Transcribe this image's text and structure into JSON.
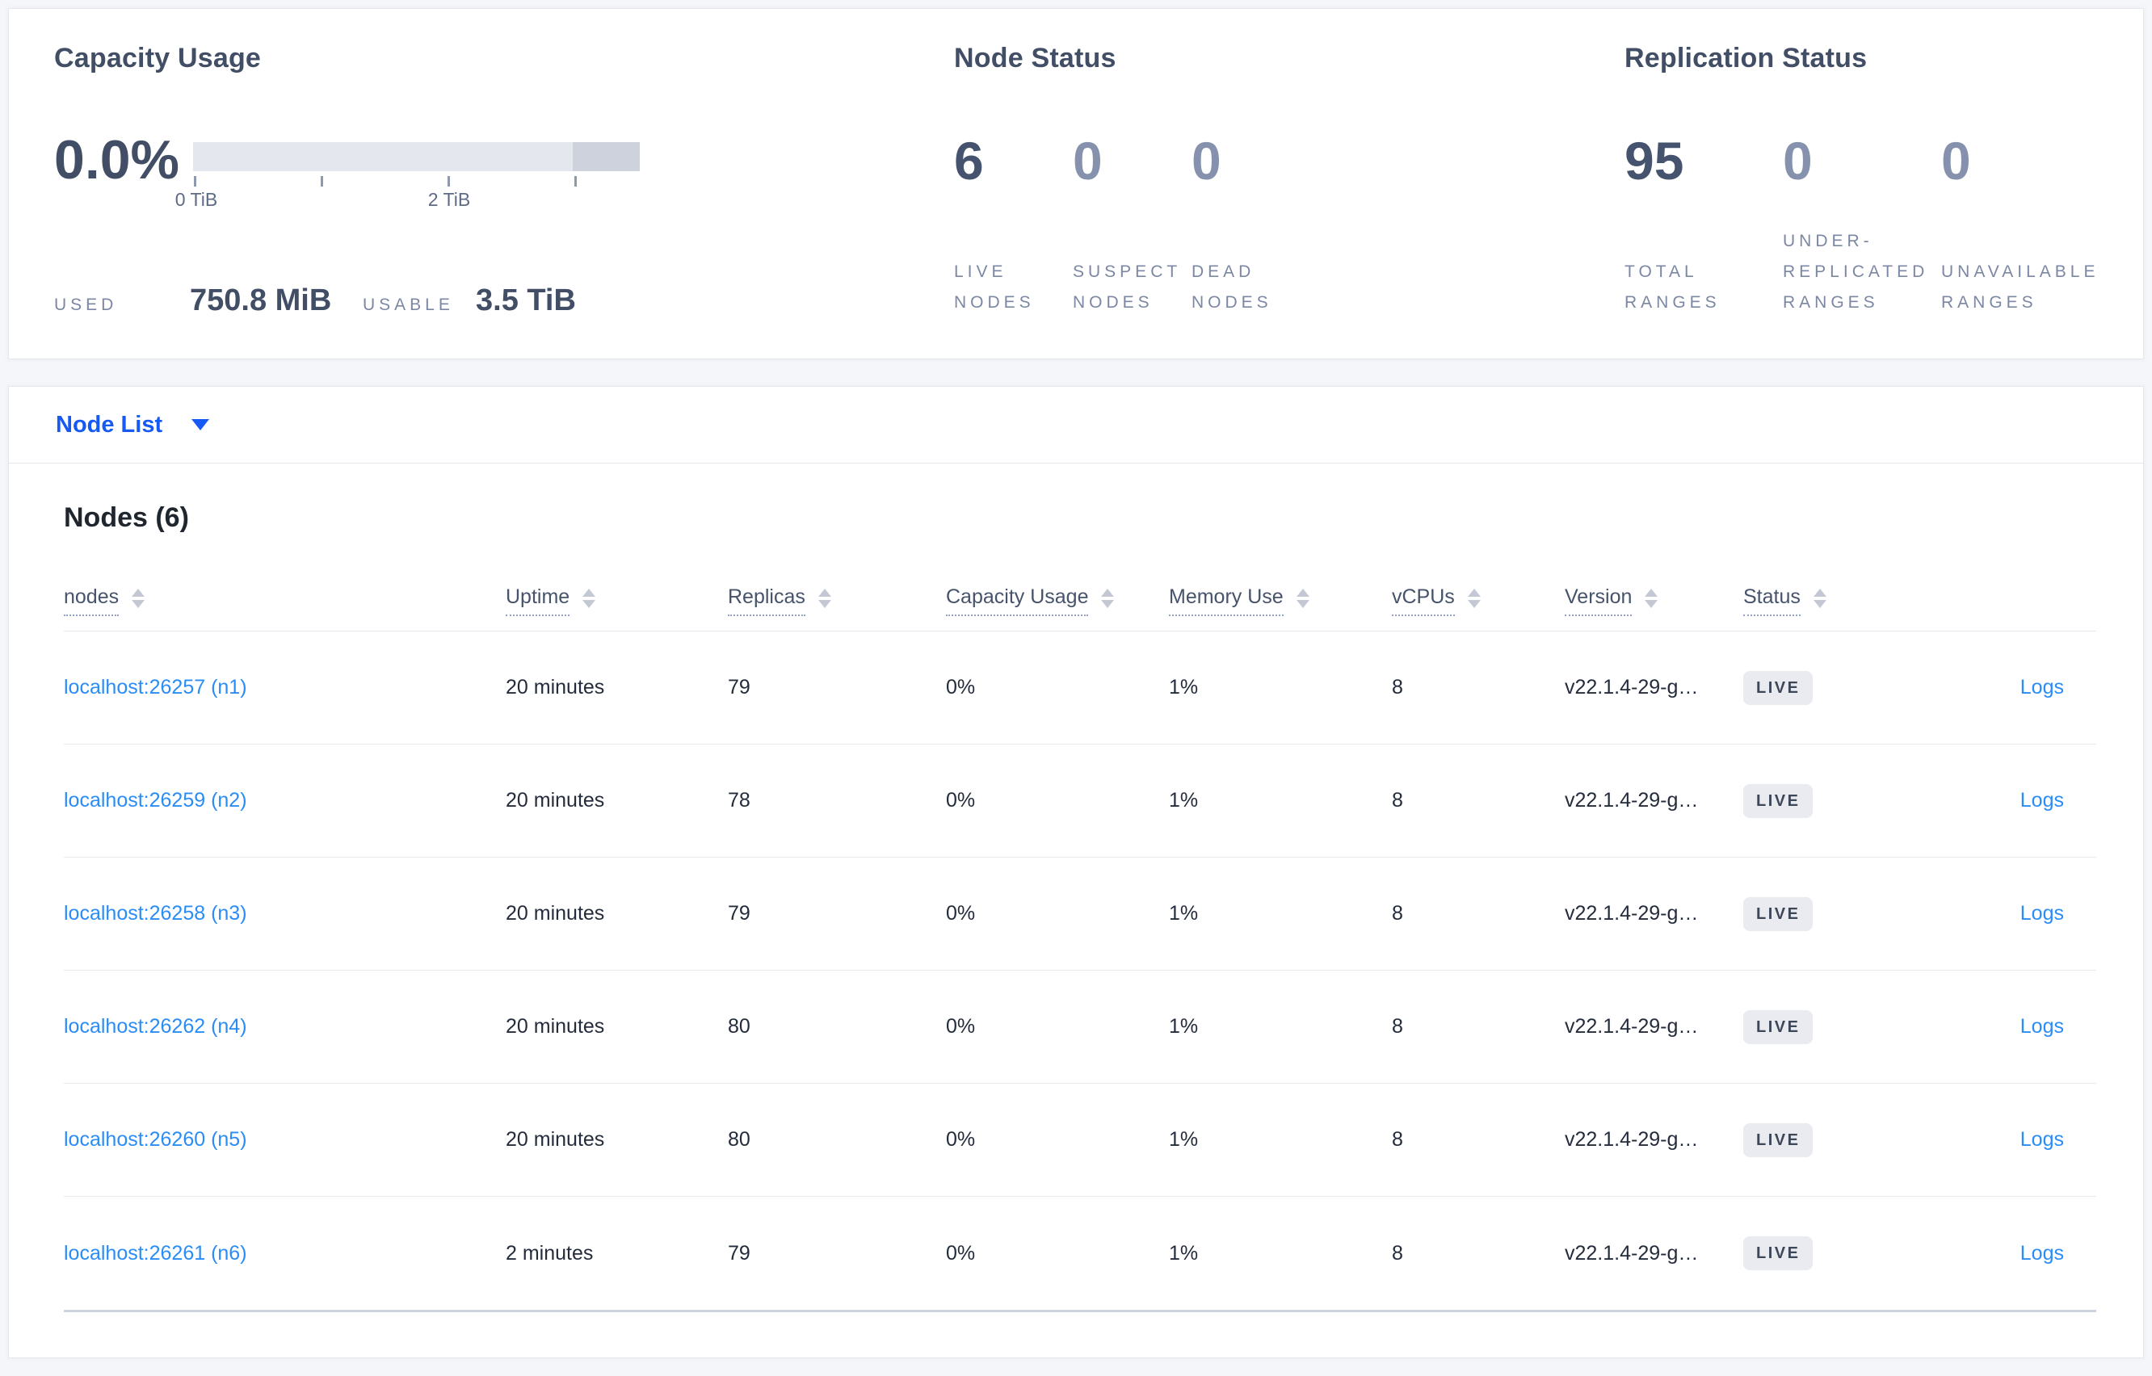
{
  "summary": {
    "capacity": {
      "title": "Capacity Usage",
      "percent_used": "0.0%",
      "axis": {
        "tick_labels": [
          "0 TiB",
          "2 TiB"
        ]
      },
      "used_label": "USED",
      "used_value": "750.8 MiB",
      "usable_label": "USABLE",
      "usable_value": "3.5 TiB"
    },
    "node_status": {
      "title": "Node Status",
      "stats": [
        {
          "value": "6",
          "label": "LIVE NODES",
          "style": "primary"
        },
        {
          "value": "0",
          "label": "SUSPECT NODES",
          "style": "muted"
        },
        {
          "value": "0",
          "label": "DEAD NODES",
          "style": "muted"
        }
      ]
    },
    "replication_status": {
      "title": "Replication Status",
      "stats": [
        {
          "value": "95",
          "label": "TOTAL RANGES",
          "style": "primary"
        },
        {
          "value": "0",
          "label": "UNDER-REPLICATED RANGES",
          "style": "muted"
        },
        {
          "value": "0",
          "label": "UNAVAILABLE RANGES",
          "style": "muted"
        }
      ]
    }
  },
  "view_selector": {
    "selected": "Node List"
  },
  "nodes_table": {
    "title": "Nodes (6)",
    "columns": [
      "nodes",
      "Uptime",
      "Replicas",
      "Capacity Usage",
      "Memory Use",
      "vCPUs",
      "Version",
      "Status"
    ],
    "logs_link_label": "Logs",
    "rows": [
      {
        "address": "localhost:26257 (n1)",
        "uptime": "20 minutes",
        "replicas": "79",
        "capacity_usage": "0%",
        "memory_use": "1%",
        "vcpus": "8",
        "version": "v22.1.4-29-g…",
        "status": "LIVE"
      },
      {
        "address": "localhost:26259 (n2)",
        "uptime": "20 minutes",
        "replicas": "78",
        "capacity_usage": "0%",
        "memory_use": "1%",
        "vcpus": "8",
        "version": "v22.1.4-29-g…",
        "status": "LIVE"
      },
      {
        "address": "localhost:26258 (n3)",
        "uptime": "20 minutes",
        "replicas": "79",
        "capacity_usage": "0%",
        "memory_use": "1%",
        "vcpus": "8",
        "version": "v22.1.4-29-g…",
        "status": "LIVE"
      },
      {
        "address": "localhost:26262 (n4)",
        "uptime": "20 minutes",
        "replicas": "80",
        "capacity_usage": "0%",
        "memory_use": "1%",
        "vcpus": "8",
        "version": "v22.1.4-29-g…",
        "status": "LIVE"
      },
      {
        "address": "localhost:26260 (n5)",
        "uptime": "20 minutes",
        "replicas": "80",
        "capacity_usage": "0%",
        "memory_use": "1%",
        "vcpus": "8",
        "version": "v22.1.4-29-g…",
        "status": "LIVE"
      },
      {
        "address": "localhost:26261 (n6)",
        "uptime": "2 minutes",
        "replicas": "79",
        "capacity_usage": "0%",
        "memory_use": "1%",
        "vcpus": "8",
        "version": "v22.1.4-29-g…",
        "status": "LIVE"
      }
    ]
  },
  "colors": {
    "accent_blue": "#1659f3",
    "link_blue": "#2a8cf5",
    "bar_light": "#e5e7ee",
    "bar_dark": "#ced2dd",
    "badge_bg": "#e9ebf1"
  }
}
